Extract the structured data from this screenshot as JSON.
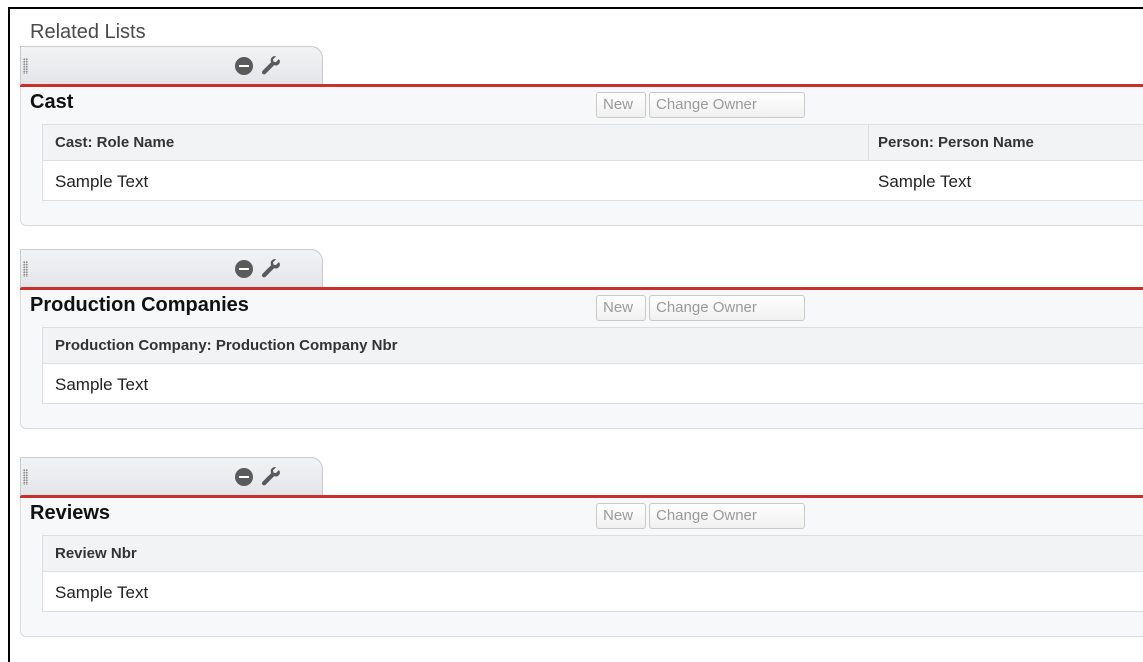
{
  "header": {
    "title": "Related Lists"
  },
  "buttons": {
    "new_label": "New",
    "change_owner_label": "Change Owner"
  },
  "icons": {
    "remove": "minus-circle-icon",
    "properties": "wrench-icon",
    "drag": "drag-handle-icon"
  },
  "colors": {
    "accent_bar": "#c9302c"
  },
  "lists": [
    {
      "title": "Cast",
      "columns": [
        "Cast: Role Name",
        "Person: Person Name"
      ],
      "rows": [
        [
          "Sample Text",
          "Sample Text"
        ]
      ]
    },
    {
      "title": "Production Companies",
      "columns": [
        "Production Company: Production Company Nbr"
      ],
      "rows": [
        [
          "Sample Text"
        ]
      ]
    },
    {
      "title": "Reviews",
      "columns": [
        "Review Nbr"
      ],
      "rows": [
        [
          "Sample Text"
        ]
      ]
    }
  ]
}
